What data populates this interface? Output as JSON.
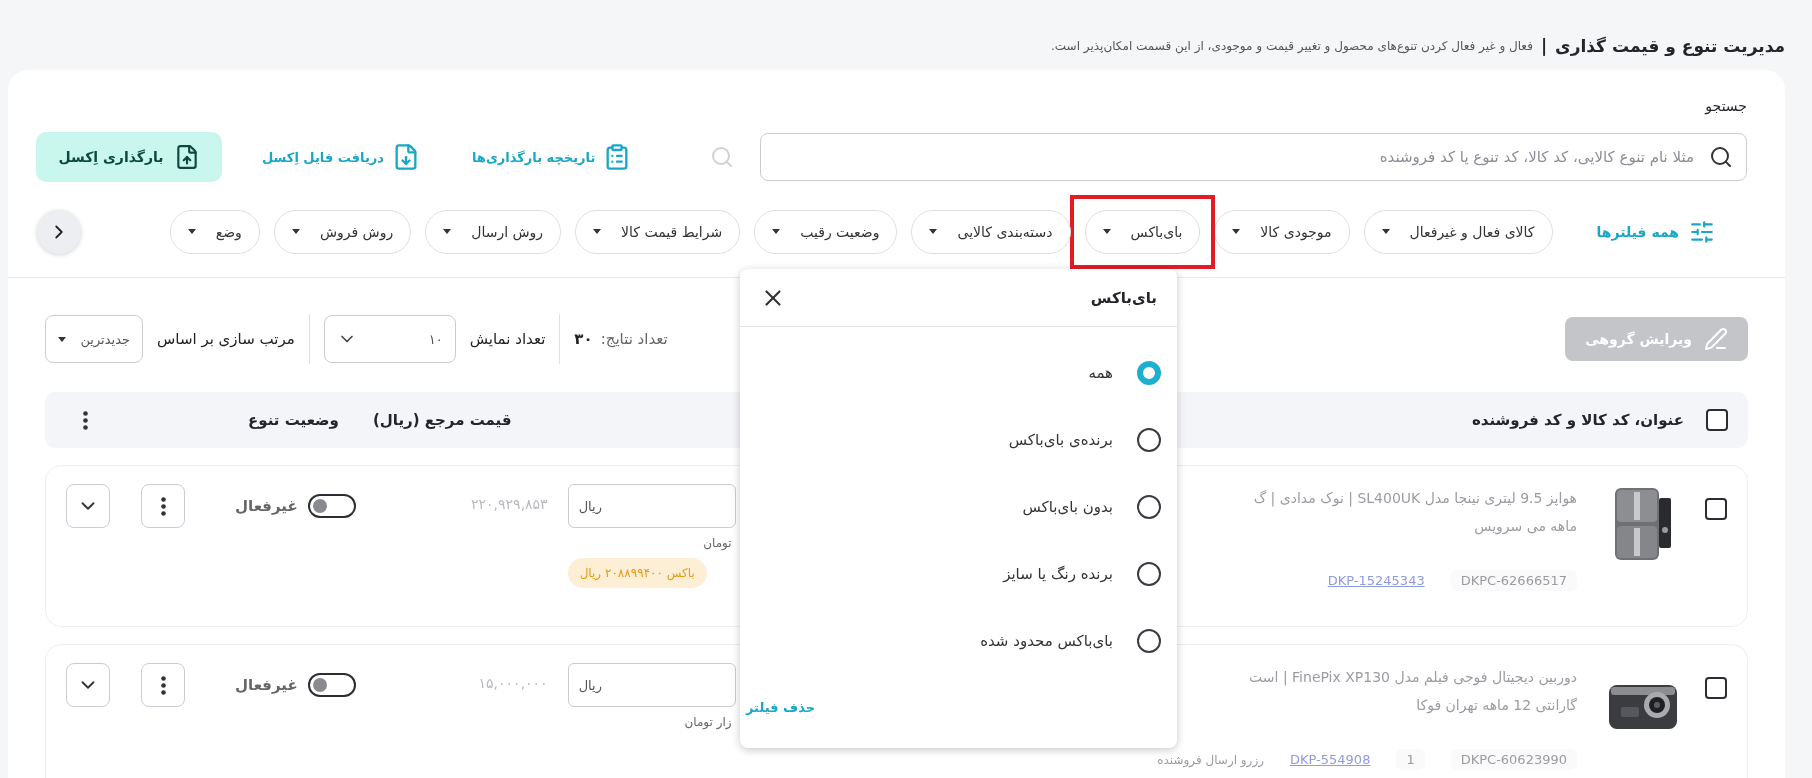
{
  "header": {
    "title": "مدیریت تنوع و قیمت گذاری",
    "separator": "|",
    "description": "فعال و غیر فعال کردن تنوع‌های محصول و تغییر قیمت و موجودی، از این قسمت امکان‌پذیر است."
  },
  "search": {
    "label": "جستجو",
    "placeholder": "مثلا نام تنوع کالایی، کد کالا، کد تنوع یا کد فروشنده"
  },
  "actions": {
    "history": "تاریخچه بارگذاری‌ها",
    "download": "دریافت فایل اِکسل",
    "upload": "بارگذاری اِکسل"
  },
  "filters": {
    "all_label": "همه فیلترها",
    "chips": [
      {
        "label": "کالای فعال و غیرفعال",
        "highlighted": false
      },
      {
        "label": "موجودی کالا",
        "highlighted": false
      },
      {
        "label": "بای‌باکس",
        "highlighted": true
      },
      {
        "label": "دسته‌بندی کالایی",
        "highlighted": false
      },
      {
        "label": "وضعیت رقیب",
        "highlighted": false
      },
      {
        "label": "شرایط قیمت کالا",
        "highlighted": false
      },
      {
        "label": "روش ارسال",
        "highlighted": false
      },
      {
        "label": "روش فروش",
        "highlighted": false
      },
      {
        "label": "وضع",
        "highlighted": false
      }
    ]
  },
  "toolbar": {
    "bulk_edit": {
      "label": "ویرایش گروهی",
      "disabled": true
    },
    "results": {
      "label": "تعداد نتایج:",
      "value": "۳۰"
    },
    "page_size": {
      "label": "تعداد نمایش",
      "value": "۱۰"
    },
    "sort": {
      "label": "مرتب سازی بر اساس",
      "value": "جدیدترین"
    }
  },
  "table": {
    "header_checked": false,
    "columns": [
      "عنوان، کد کالا و کد فروشنده",
      "قیمت مرجع (ریال)",
      "وضعیت تنوع"
    ],
    "rows": [
      {
        "checked": false,
        "title_lines": [
          "هواپز 9.5 لیتری نینجا مدل SL400UK | نوک مدادی | گ",
          "ماهه می سرویس"
        ],
        "codes": [
          "DKPC-62666517"
        ],
        "product_code": "DKP-15245343",
        "price_placeholder": "ریال",
        "price_hint": "تومان",
        "badge": "باکس ۲۰۸۸۹۹۴۰۰ ریال",
        "reference_price": "۲۲۰,۹۲۹,۸۵۳",
        "active": false,
        "status": "غیرفعال"
      },
      {
        "checked": false,
        "title_lines": [
          "دوربین دیجیتال فوجی فیلم مدل FinePix XP130 | است",
          "گارانتی 12 ماهه تهران فوکا"
        ],
        "codes": [
          "DKPC-60623990",
          "1"
        ],
        "product_code": "DKP-554908",
        "note": "رزرو ارسال فروشنده",
        "price_placeholder": "ریال",
        "price_hint": "زار تومان",
        "reference_price": "۱۵,۰۰۰,۰۰۰",
        "active": false,
        "status": "غیرفعال"
      }
    ]
  },
  "popup": {
    "title": "بای‌باکس",
    "options": [
      {
        "label": "همه",
        "selected": true
      },
      {
        "label": "برنده‌ی بای‌باکس",
        "selected": false
      },
      {
        "label": "بدون بای‌باکس",
        "selected": false
      },
      {
        "label": "برنده رنگ یا سایز",
        "selected": false
      },
      {
        "label": "بای‌باکس محدود شده",
        "selected": false
      }
    ],
    "clear": "حذف فیلتر"
  }
}
